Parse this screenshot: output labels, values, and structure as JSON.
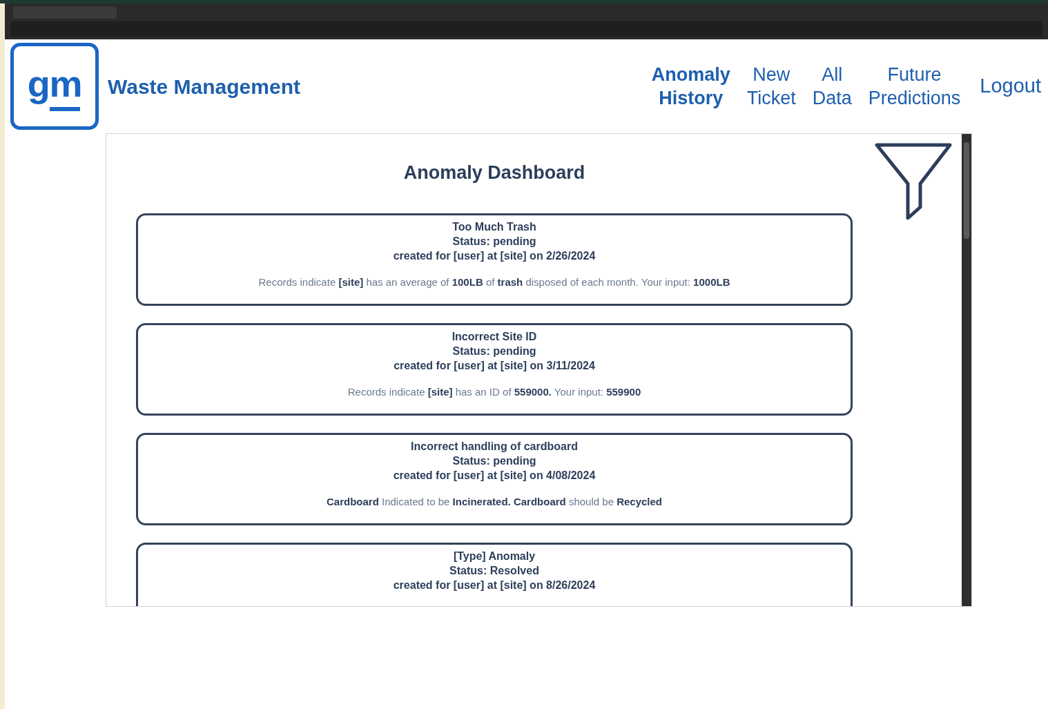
{
  "header": {
    "logo": "gm",
    "title": "Waste Management"
  },
  "nav": [
    {
      "label": "Anomaly History",
      "selected": true
    },
    {
      "label": "New Ticket",
      "selected": false
    },
    {
      "label": "All Data",
      "selected": false
    },
    {
      "label": "Future Predictions",
      "selected": false
    }
  ],
  "logout": "Logout",
  "dashboard": {
    "title": "Anomaly Dashboard",
    "cards": [
      {
        "title": "Too Much Trash",
        "status": "Status: pending",
        "created": "created for [user] at [site] on 2/26/2024",
        "message": "Records indicate **[site]** has an average of **100LB** of **trash** disposed of each month. Your input: **1000LB**"
      },
      {
        "title": "Incorrect Site ID",
        "status": "Status: pending",
        "created": "created for [user] at [site] on 3/11/2024",
        "message": "Records indicate **[site]** has an ID of **559000.** Your input: **559900**"
      },
      {
        "title": "Incorrect handling of cardboard",
        "status": "Status: pending",
        "created": "created for [user] at [site] on 4/08/2024",
        "message": "**Cardboard** Indicated to be **Incinerated. Cardboard** should be **Recycled**"
      },
      {
        "title": "[Type] Anomaly",
        "status": "Status: Resolved",
        "created": "created for [user] at [site] on 8/26/2024"
      }
    ]
  }
}
